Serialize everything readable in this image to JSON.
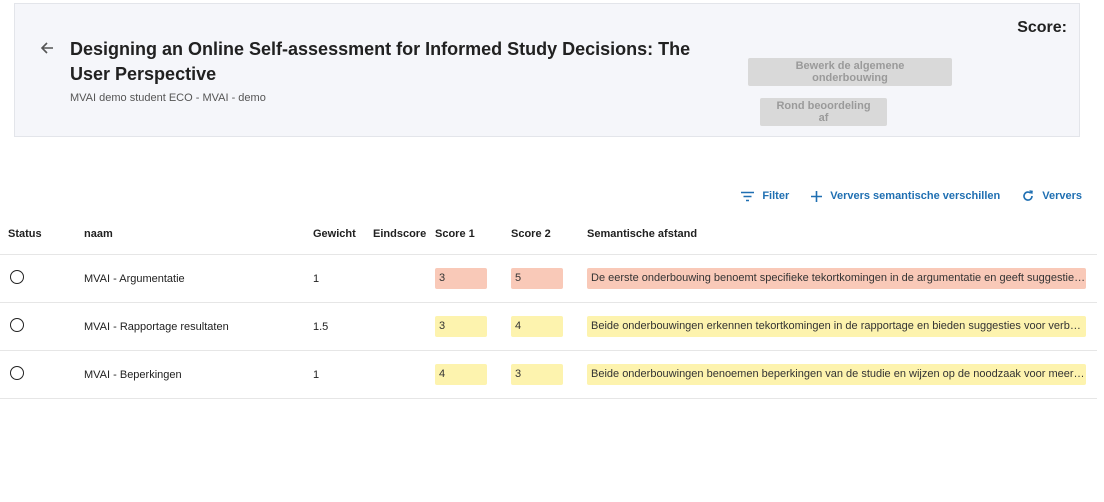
{
  "header": {
    "title": "Designing an Online Self-assessment for Informed Study Decisions: The User Perspective",
    "subtitle": "MVAI demo student ECO - MVAI - demo",
    "score_label": "Score:",
    "edit_button": "Bewerk de algemene onderbouwing",
    "finish_button": "Rond beoordeling af"
  },
  "toolbar": {
    "filter": "Filter",
    "refresh_semantic": "Ververs semantische verschillen",
    "refresh": "Ververs"
  },
  "table": {
    "columns": [
      "Status",
      "naam",
      "Gewicht",
      "Eindscore",
      "Score 1",
      "Score 2",
      "Semantische afstand"
    ],
    "rows": [
      {
        "naam": "MVAI - Argumentatie",
        "gewicht": "1",
        "eindscore": "",
        "score1": "3",
        "score2": "5",
        "semantic": "De eerste onderbouwing benoemt specifieke tekortkomingen in de argumentatie en geeft suggesties…",
        "color": "#f9c9b8"
      },
      {
        "naam": "MVAI - Rapportage resultaten",
        "gewicht": "1.5",
        "eindscore": "",
        "score1": "3",
        "score2": "4",
        "semantic": "Beide onderbouwingen erkennen tekortkomingen in de rapportage en bieden suggesties voor verbet…",
        "color": "#fdf3ae"
      },
      {
        "naam": "MVAI - Beperkingen",
        "gewicht": "1",
        "eindscore": "",
        "score1": "4",
        "score2": "3",
        "semantic": "Beide onderbouwingen benoemen beperkingen van de studie en wijzen op de noodzaak voor meer di…",
        "color": "#fdf3ae"
      }
    ]
  },
  "colors": {
    "accent": "#1f6fb2",
    "chip_red": "#f9c9b8",
    "chip_yellow": "#fdf3ae"
  }
}
